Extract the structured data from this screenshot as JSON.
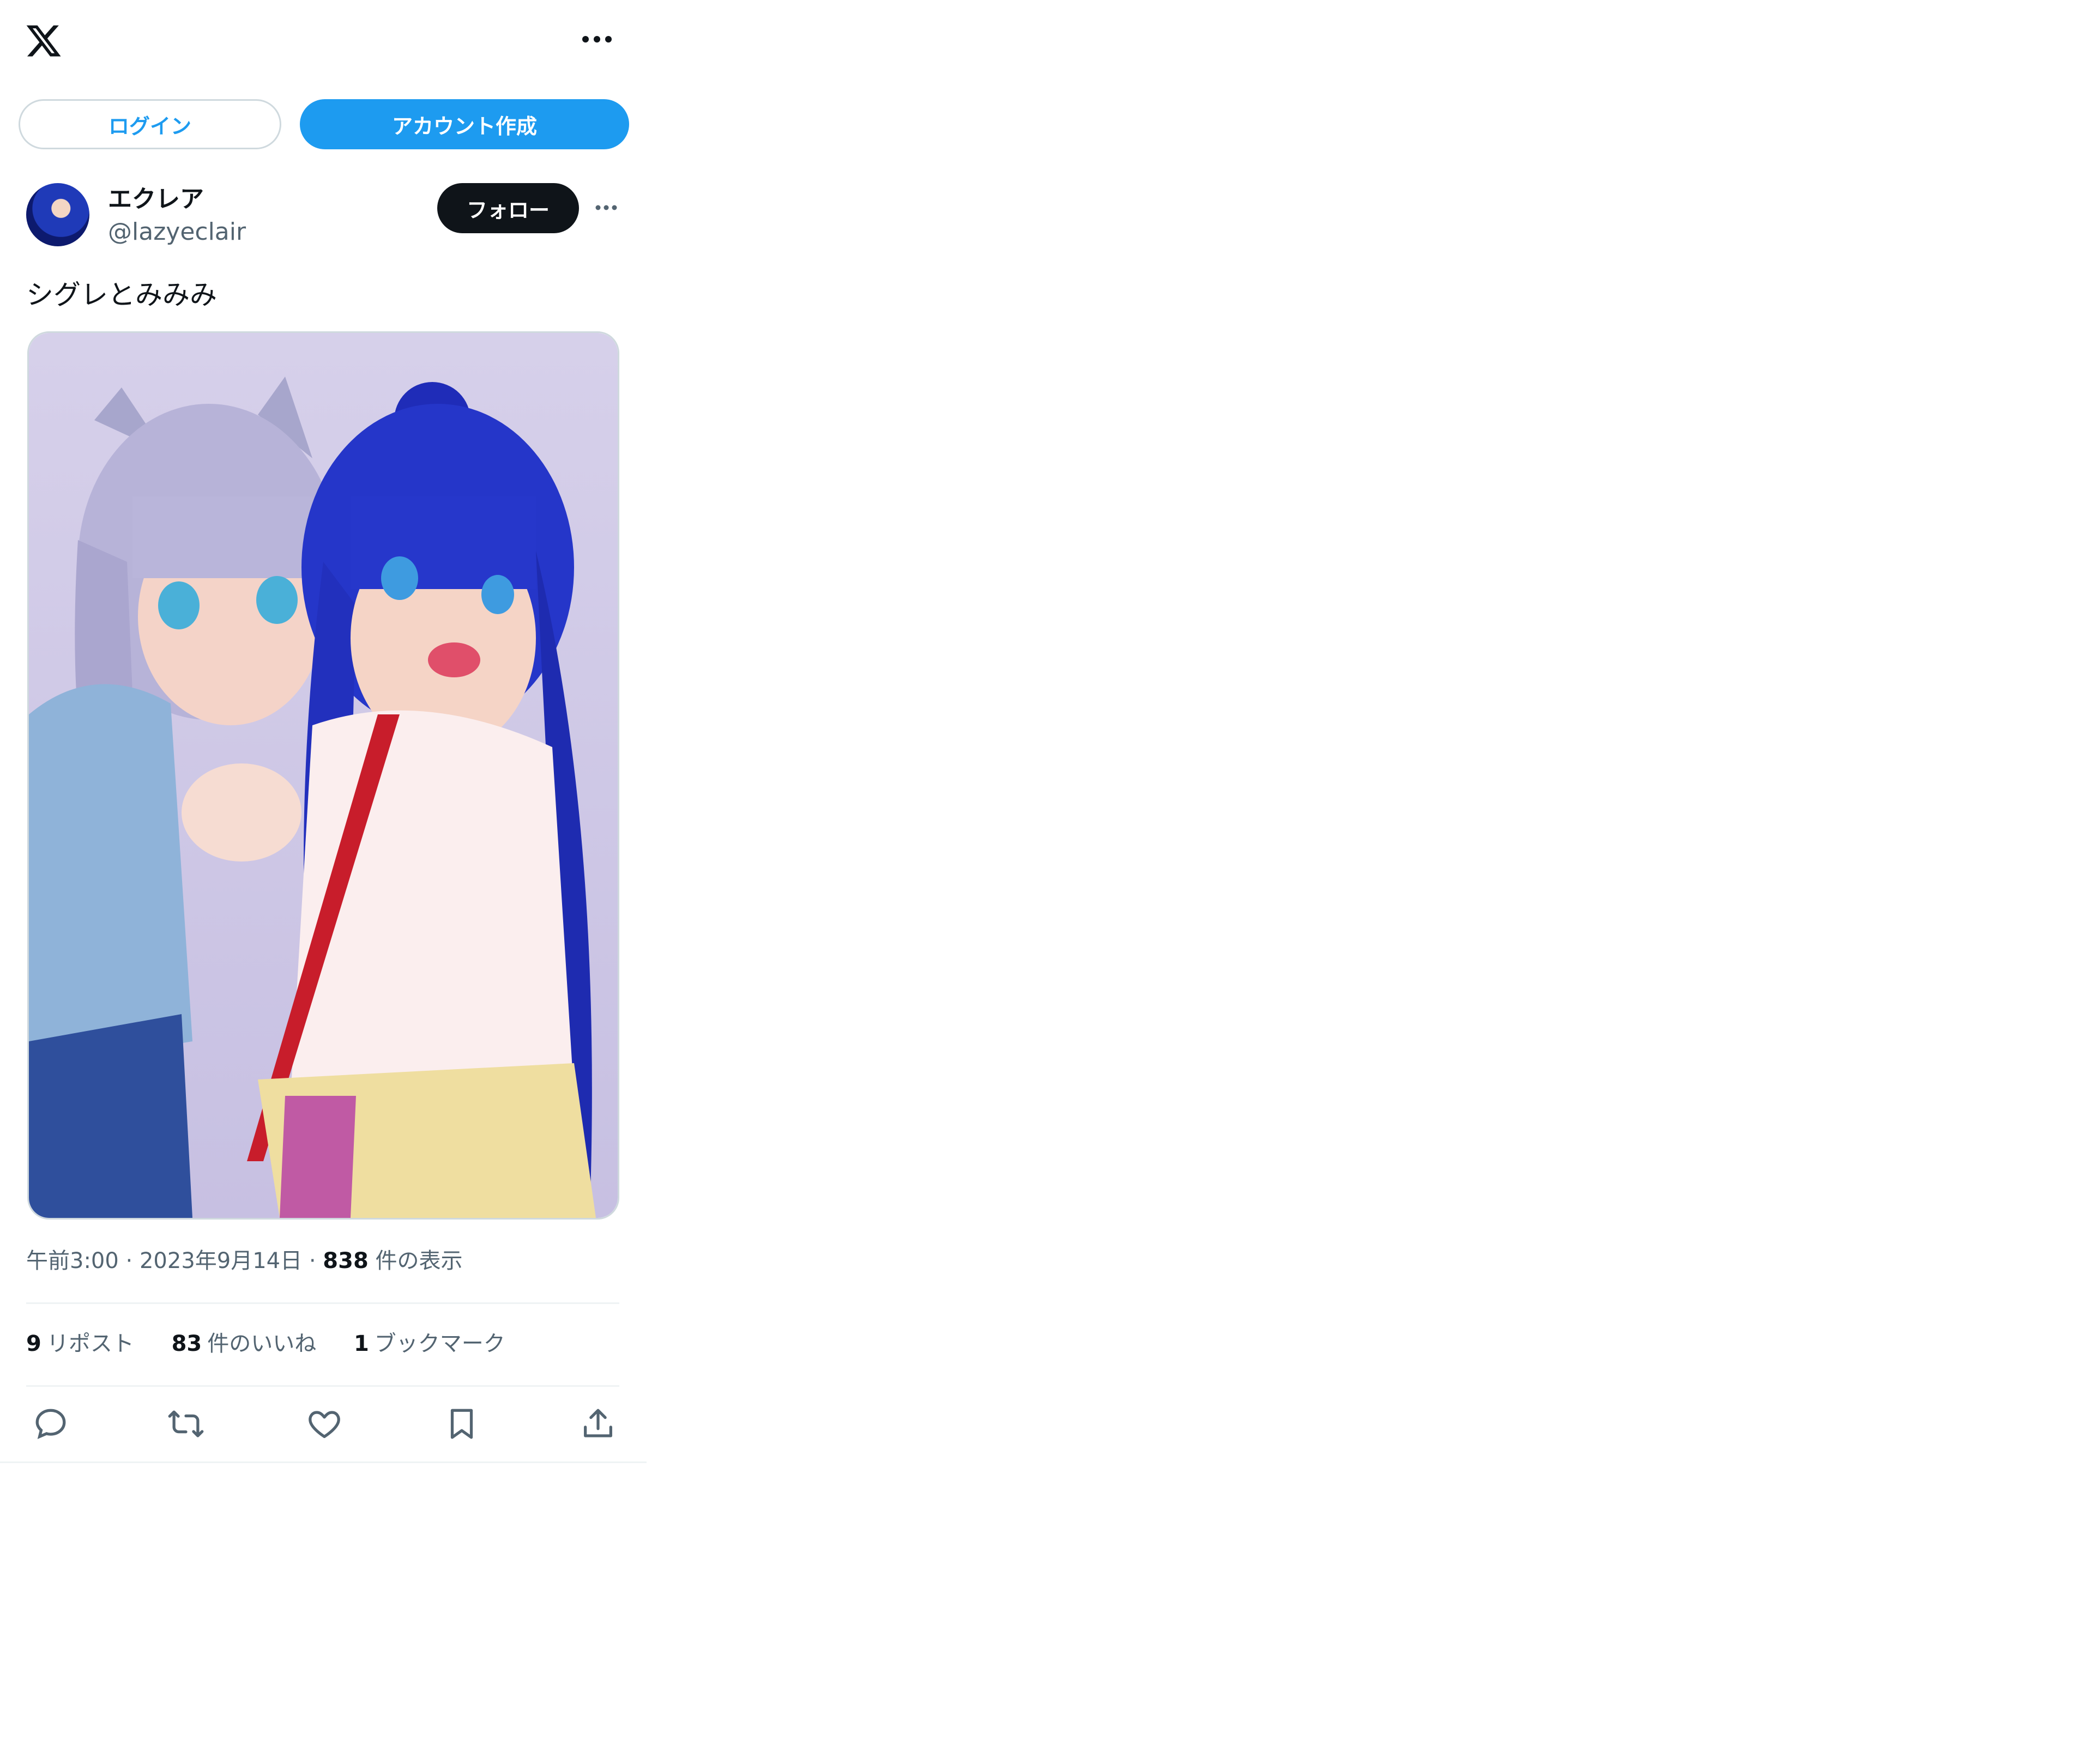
{
  "header": {
    "logo_icon": "x-logo-icon",
    "more_icon": "more-horizontal-icon"
  },
  "auth": {
    "login_label": "ログイン",
    "signup_label": "アカウント作成",
    "accent_color": "#1d9bf0"
  },
  "tweet": {
    "author": {
      "name": "エクレア",
      "handle": "@lazyeclair"
    },
    "follow_label": "フォロー",
    "text": "シグレとみみみ",
    "media_description_icon": "photo",
    "meta": {
      "time": "午前3:00",
      "date": "2023年9月14日",
      "views_count": "838",
      "views_label": "件の表示"
    },
    "stats": {
      "reposts_count": "9",
      "reposts_label": "リポスト",
      "likes_count": "83",
      "likes_label": "件のいいね",
      "bookmarks_count": "1",
      "bookmarks_label": "ブックマーク"
    },
    "actions": [
      "reply-icon",
      "repost-icon",
      "like-icon",
      "bookmark-icon",
      "share-icon"
    ]
  }
}
